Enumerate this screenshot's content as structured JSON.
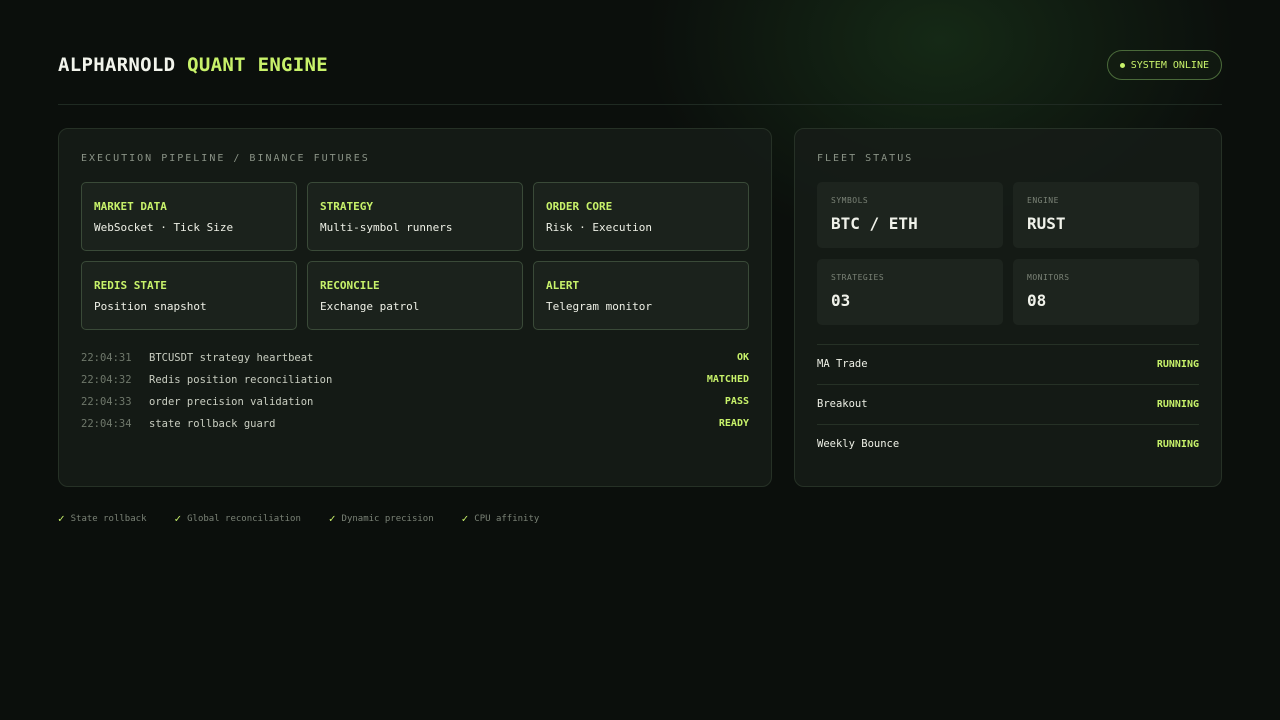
{
  "header": {
    "brand_main": "ALPHARNOLD",
    "brand_accent": "QUANT ENGINE",
    "status_label": "SYSTEM ONLINE"
  },
  "pipeline": {
    "title": "EXECUTION PIPELINE / BINANCE FUTURES",
    "cards": [
      {
        "title": "MARKET DATA",
        "desc": "WebSocket · Tick Size"
      },
      {
        "title": "STRATEGY",
        "desc": "Multi-symbol runners"
      },
      {
        "title": "ORDER CORE",
        "desc": "Risk · Execution"
      },
      {
        "title": "REDIS STATE",
        "desc": "Position snapshot"
      },
      {
        "title": "RECONCILE",
        "desc": "Exchange patrol"
      },
      {
        "title": "ALERT",
        "desc": "Telegram monitor"
      }
    ],
    "logs": [
      {
        "time": "22:04:31",
        "message": "BTCUSDT strategy heartbeat",
        "status": "OK"
      },
      {
        "time": "22:04:32",
        "message": "Redis position reconciliation",
        "status": "MATCHED"
      },
      {
        "time": "22:04:33",
        "message": "order precision validation",
        "status": "PASS"
      },
      {
        "time": "22:04:34",
        "message": "state rollback guard",
        "status": "READY"
      }
    ]
  },
  "fleet": {
    "title": "FLEET STATUS",
    "stats": [
      {
        "label": "SYMBOLS",
        "value": "BTC / ETH"
      },
      {
        "label": "ENGINE",
        "value": "RUST"
      },
      {
        "label": "STRATEGIES",
        "value": "03"
      },
      {
        "label": "MONITORS",
        "value": "08"
      }
    ],
    "strategies": [
      {
        "name": "MA Trade",
        "status": "RUNNING"
      },
      {
        "name": "Breakout",
        "status": "RUNNING"
      },
      {
        "name": "Weekly Bounce",
        "status": "RUNNING"
      }
    ]
  },
  "features": [
    {
      "label": "State rollback"
    },
    {
      "label": "Global reconciliation"
    },
    {
      "label": "Dynamic precision"
    },
    {
      "label": "CPU affinity"
    }
  ],
  "icons": {
    "check": "check-icon",
    "status_dot": "status-dot-icon"
  },
  "colors": {
    "accent": "#c8f26a",
    "background": "#0b0f0c",
    "panel": "#161c17"
  }
}
